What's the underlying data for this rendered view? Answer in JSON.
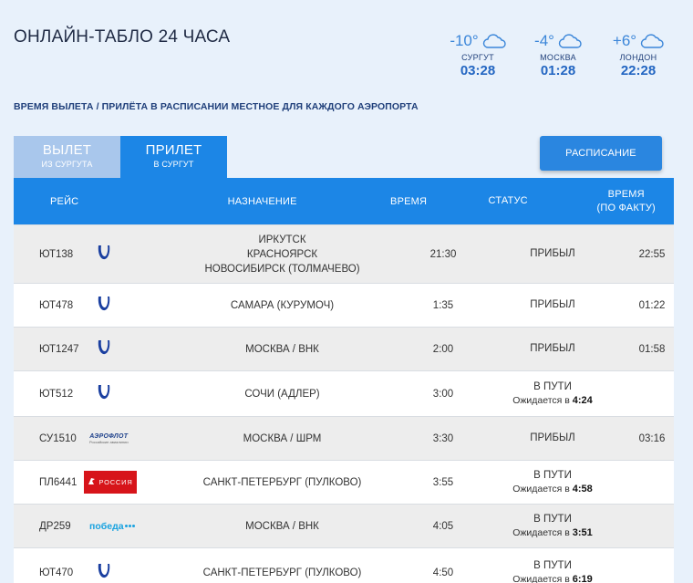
{
  "page": {
    "title": "ОНЛАЙН-ТАБЛО 24 ЧАСА",
    "note": "ВРЕМЯ ВЫЛЕТА / ПРИЛЁТА В РАСПИСАНИИ МЕСТНОЕ ДЛЯ КАЖДОГО АЭРОПОРТА"
  },
  "weather": [
    {
      "temp": "-10°",
      "city": "СУРГУТ",
      "time": "03:28"
    },
    {
      "temp": "-4°",
      "city": "МОСКВА",
      "time": "01:28"
    },
    {
      "temp": "+6°",
      "city": "ЛОНДОН",
      "time": "22:28"
    }
  ],
  "tabs": [
    {
      "label": "ВЫЛЕТ",
      "sub": "ИЗ СУРГУТА",
      "active": false
    },
    {
      "label": "ПРИЛЕТ",
      "sub": "В СУРГУТ",
      "active": true
    }
  ],
  "schedule_button": "РАСПИСАНИЕ",
  "table": {
    "headers": {
      "flight": "РЕЙС",
      "destination": "НАЗНАЧЕНИЕ",
      "time": "ВРЕМЯ",
      "status": "СТАТУС",
      "actual_line1": "ВРЕМЯ",
      "actual_line2": "(ПО ФАКТУ)"
    },
    "rows": [
      {
        "flight": "ЮТ138",
        "airline": "utair",
        "dest1": "ИРКУТСК",
        "dest2": "КРАСНОЯРСК",
        "dest3": "НОВОСИБИРСК (ТОЛМАЧЕВО)",
        "time": "21:30",
        "status": "ПРИБЫЛ",
        "expected_label": "",
        "expected_time": "",
        "actual": "22:55"
      },
      {
        "flight": "ЮТ478",
        "airline": "utair",
        "dest1": "САМАРА (КУРУМОЧ)",
        "dest2": "",
        "dest3": "",
        "time": "1:35",
        "status": "ПРИБЫЛ",
        "expected_label": "",
        "expected_time": "",
        "actual": "01:22"
      },
      {
        "flight": "ЮТ1247",
        "airline": "utair",
        "dest1": "МОСКВА / ВНК",
        "dest2": "",
        "dest3": "",
        "time": "2:00",
        "status": "ПРИБЫЛ",
        "expected_label": "",
        "expected_time": "",
        "actual": "01:58"
      },
      {
        "flight": "ЮТ512",
        "airline": "utair",
        "dest1": "СОЧИ (АДЛЕР)",
        "dest2": "",
        "dest3": "",
        "time": "3:00",
        "status": "В ПУТИ",
        "expected_label": "Ожидается в",
        "expected_time": "4:24",
        "actual": ""
      },
      {
        "flight": "СУ1510",
        "airline": "aeroflot",
        "dest1": "МОСКВА / ШРМ",
        "dest2": "",
        "dest3": "",
        "time": "3:30",
        "status": "ПРИБЫЛ",
        "expected_label": "",
        "expected_time": "",
        "actual": "03:16"
      },
      {
        "flight": "ПЛ6441",
        "airline": "rossiya",
        "dest1": "САНКТ-ПЕТЕРБУРГ (ПУЛКОВО)",
        "dest2": "",
        "dest3": "",
        "time": "3:55",
        "status": "В ПУТИ",
        "expected_label": "Ожидается в",
        "expected_time": "4:58",
        "actual": ""
      },
      {
        "flight": "ДР259",
        "airline": "pobeda",
        "dest1": "МОСКВА / ВНК",
        "dest2": "",
        "dest3": "",
        "time": "4:05",
        "status": "В ПУТИ",
        "expected_label": "Ожидается в",
        "expected_time": "3:51",
        "actual": ""
      },
      {
        "flight": "ЮТ470",
        "airline": "utair",
        "dest1": "САНКТ-ПЕТЕРБУРГ (ПУЛКОВО)",
        "dest2": "",
        "dest3": "",
        "time": "4:50",
        "status": "В ПУТИ",
        "expected_label": "Ожидается в",
        "expected_time": "6:19",
        "actual": ""
      }
    ]
  },
  "logos": {
    "aeroflot_text": "АЭРОФЛОТ",
    "aeroflot_sub": "Российские авиалинии",
    "rossiya_text": "РОССИЯ",
    "pobeda_text": "победа"
  },
  "colors": {
    "accent": "#1c86e6",
    "tab_inactive": "#a9c7ec",
    "background": "#e8f1fb",
    "row_grey": "#ededed",
    "utair_logo": "#1a3fa0",
    "rossiya_red": "#d7141a",
    "pobeda_blue": "#1aa3e0"
  },
  "icons": {
    "weather": "cloud-icon",
    "utair": "utair-logo-icon"
  }
}
